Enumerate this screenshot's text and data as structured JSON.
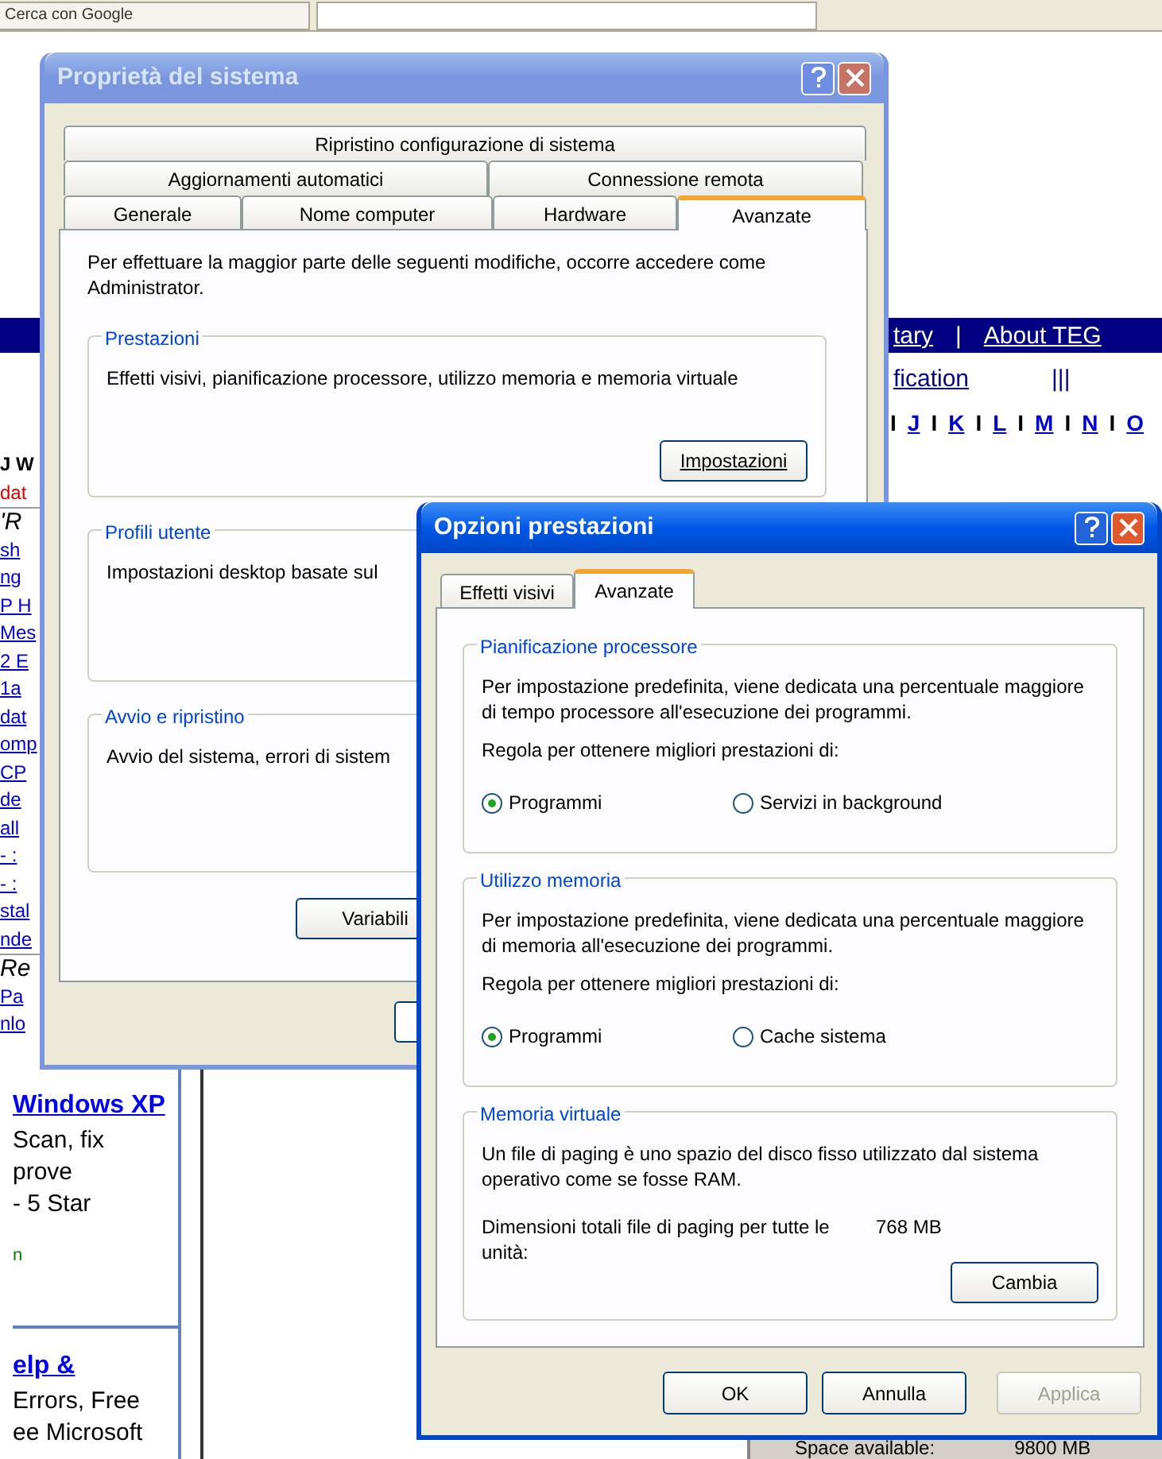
{
  "browser": {
    "tabs": [
      {
        "label": "Cerca con Google",
        "selected": false
      },
      {
        "selected": true
      }
    ],
    "nav_links": [
      "tary",
      "|",
      "About TEG"
    ],
    "nav_links_2": [
      "fication",
      "|||"
    ],
    "letters": [
      "I",
      "J",
      "I",
      "K",
      "I",
      "L",
      "I",
      "M",
      "I",
      "N",
      "I",
      "O"
    ],
    "left_column": [
      {
        "text": "J W",
        "kind": "heading"
      },
      {
        "text": "dat",
        "kind": "alert"
      },
      {
        "text": "'R",
        "kind": "italic"
      },
      {
        "text": "sh",
        "kind": "link"
      },
      {
        "text": "ng",
        "kind": "link"
      },
      {
        "text": "P H",
        "kind": "link"
      },
      {
        "text": "Mes",
        "kind": "link"
      },
      {
        "text": "2 E",
        "kind": "link"
      },
      {
        "text": "1a",
        "kind": "link"
      },
      {
        "text": "dat",
        "kind": "link"
      },
      {
        "text": "omp",
        "kind": "link"
      },
      {
        "text": "CP",
        "kind": "link"
      },
      {
        "text": "de",
        "kind": "link"
      },
      {
        "text": "all",
        "kind": "link"
      },
      {
        "text": "- :",
        "kind": "link"
      },
      {
        "text": "- :",
        "kind": "link"
      },
      {
        "text": "stal",
        "kind": "link"
      },
      {
        "text": "nde",
        "kind": "link"
      },
      {
        "text": "Re",
        "kind": "italic"
      },
      {
        "text": "Pa",
        "kind": "link"
      },
      {
        "text": "nlo",
        "kind": "link"
      }
    ],
    "ads": [
      {
        "title": "Windows XP",
        "lines": [
          "Scan, fix",
          "prove",
          "- 5 Star"
        ],
        "footer": "n"
      },
      {
        "title": "elp &",
        "lines": [
          "Errors, Free",
          "ee Microsoft"
        ]
      }
    ],
    "status": {
      "label": "Space available:",
      "value": "9800 MB"
    }
  },
  "system_properties": {
    "title": "Proprietà del sistema",
    "active": false,
    "tab_rows": [
      [
        {
          "label": "Ripristino configurazione di sistema",
          "selected": false
        }
      ],
      [
        {
          "label": "Aggiornamenti automatici",
          "selected": false
        },
        {
          "label": "Connessione remota",
          "selected": false
        }
      ],
      [
        {
          "label": "Generale",
          "selected": false
        },
        {
          "label": "Nome computer",
          "selected": false
        },
        {
          "label": "Hardware",
          "selected": false
        },
        {
          "label": "Avanzate",
          "selected": true
        }
      ]
    ],
    "intro": "Per effettuare la maggior parte delle seguenti modifiche, occorre accedere come Administrator.",
    "groups": [
      {
        "title": "Prestazioni",
        "text": "Effetti visivi, pianificazione processore, utilizzo memoria e memoria virtuale",
        "button": "Impostazioni"
      },
      {
        "title": "Profili utente",
        "text": "Impostazioni desktop basate sul"
      },
      {
        "title": "Avvio e ripristino",
        "text": "Avvio del sistema, errori di sistem"
      }
    ],
    "buttons": [
      "Variabili"
    ]
  },
  "performance_options": {
    "title": "Opzioni prestazioni",
    "active": true,
    "tabs": [
      {
        "label": "Effetti visivi",
        "selected": false
      },
      {
        "label": "Avanzate",
        "selected": true
      }
    ],
    "groups": [
      {
        "title": "Pianificazione processore",
        "text": "Per impostazione predefinita, viene dedicata una percentuale maggiore di tempo processore all'esecuzione dei programmi.",
        "prompt": "Regola per ottenere migliori prestazioni di:",
        "options": [
          {
            "label": "Programmi",
            "selected": true
          },
          {
            "label": "Servizi in background",
            "selected": false
          }
        ]
      },
      {
        "title": "Utilizzo memoria",
        "text": "Per impostazione predefinita, viene dedicata una percentuale maggiore di memoria all'esecuzione dei programmi.",
        "prompt": "Regola per ottenere migliori prestazioni di:",
        "options": [
          {
            "label": "Programmi",
            "selected": true
          },
          {
            "label": "Cache sistema",
            "selected": false
          }
        ]
      },
      {
        "title": "Memoria virtuale",
        "text": "Un file di paging è uno spazio del disco fisso utilizzato dal sistema operativo come se fosse RAM.",
        "size_label": "Dimensioni totali file di paging per tutte le unità:",
        "size_value": "768 MB",
        "button": "Cambia"
      }
    ],
    "buttons": [
      {
        "label": "OK",
        "disabled": false
      },
      {
        "label": "Annulla",
        "disabled": false
      },
      {
        "label": "Applica",
        "disabled": true
      }
    ]
  }
}
